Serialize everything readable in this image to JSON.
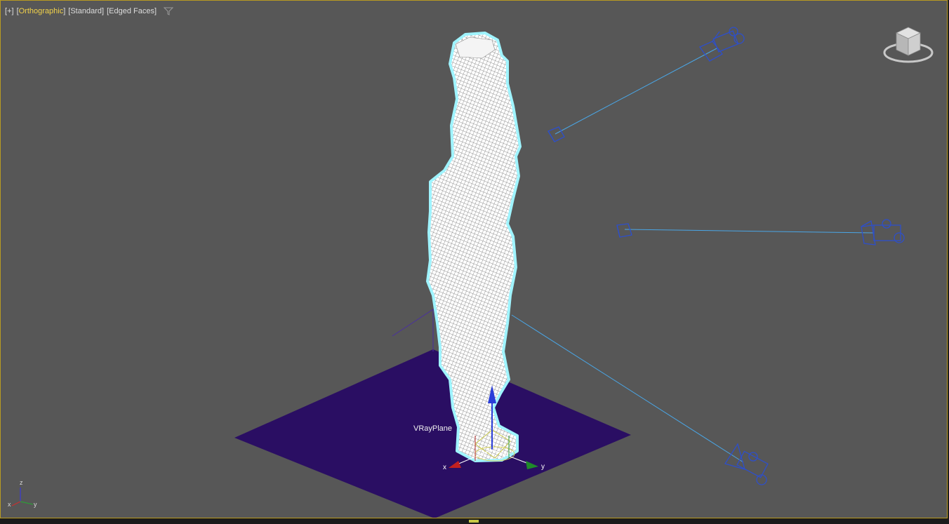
{
  "viewport_labels": {
    "plus": "+",
    "view": "Orthographic",
    "shading": "Standard",
    "edges": "Edged Faces"
  },
  "object": {
    "name": "VRayPlane"
  },
  "gizmo": {
    "x": "x",
    "y": "y"
  },
  "triad": {
    "x": "x",
    "y": "y",
    "z": "z"
  },
  "colors": {
    "viewport_bg": "#575757",
    "border_active": "#b89a22",
    "label_highlight": "#f2d24a",
    "plane": "#2a0e63",
    "camera": "#2e4fc9",
    "target_line": "#4aa6e6",
    "selection_outline": "#9ff4ff"
  }
}
